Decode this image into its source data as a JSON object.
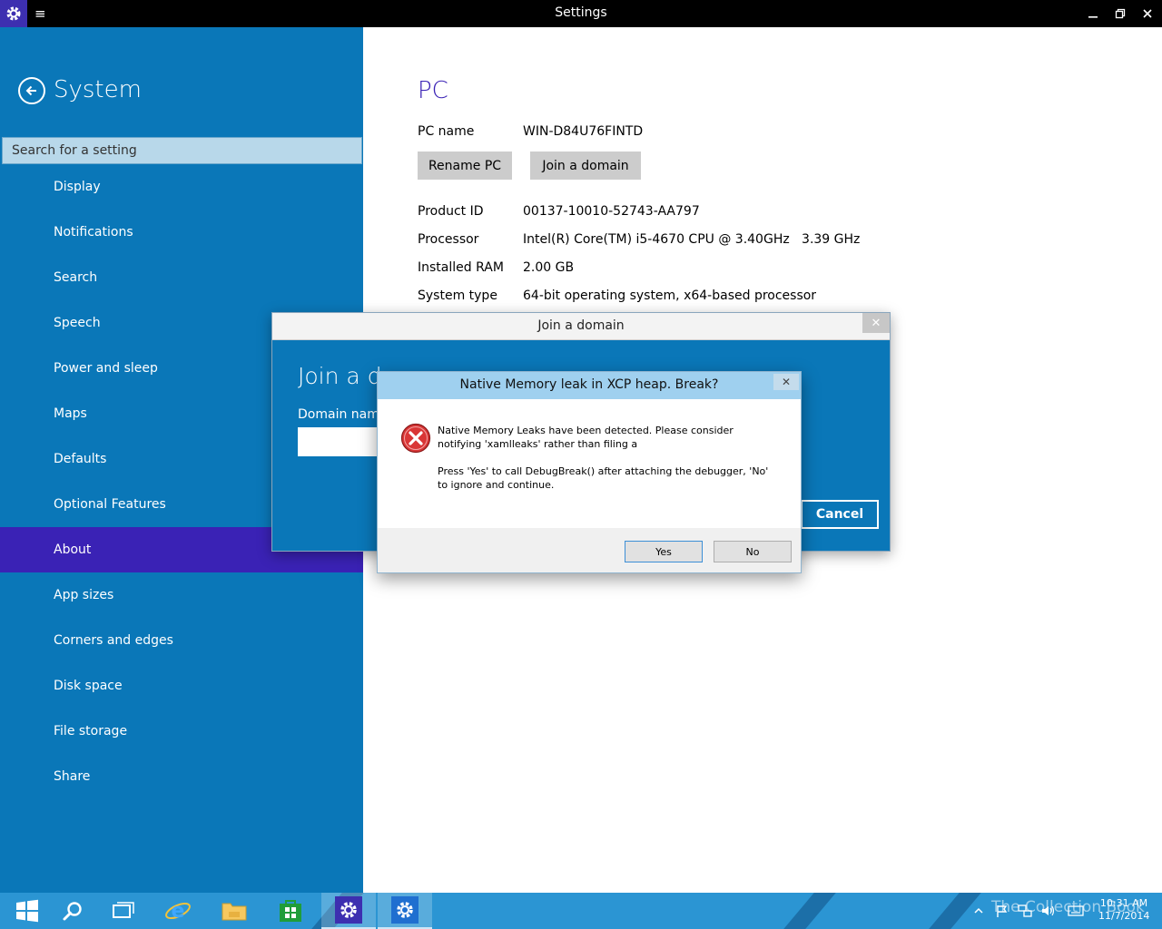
{
  "window": {
    "title": "Settings"
  },
  "sidebar": {
    "title": "System",
    "search_placeholder": "Search for a setting",
    "items": [
      {
        "label": "Display"
      },
      {
        "label": "Notifications"
      },
      {
        "label": "Search"
      },
      {
        "label": "Speech"
      },
      {
        "label": "Power and sleep"
      },
      {
        "label": "Maps"
      },
      {
        "label": "Defaults"
      },
      {
        "label": "Optional Features"
      },
      {
        "label": "About",
        "active": true
      },
      {
        "label": "App sizes"
      },
      {
        "label": "Corners and edges"
      },
      {
        "label": "Disk space"
      },
      {
        "label": "File storage"
      },
      {
        "label": "Share"
      }
    ]
  },
  "main": {
    "heading": "PC",
    "pc_name_label": "PC name",
    "pc_name_value": "WIN-D84U76FINTD",
    "rename_button": "Rename PC",
    "join_button": "Join a domain",
    "details": [
      {
        "label": "Product ID",
        "value": "00137-10010-52743-AA797"
      },
      {
        "label": "Processor",
        "value": "Intel(R) Core(TM) i5-4670 CPU @ 3.40GHz   3.39 GHz"
      },
      {
        "label": "Installed RAM",
        "value": "2.00 GB"
      },
      {
        "label": "System type",
        "value": "64-bit operating system, x64-based processor"
      }
    ]
  },
  "join_dialog": {
    "title": "Join a domain",
    "heading_visible": "Join a d",
    "domain_label_visible": "Domain name",
    "cancel_button": "Cancel"
  },
  "message_box": {
    "title": "Native Memory leak in XCP heap. Break?",
    "line1": "Native Memory Leaks have been detected. Please consider notifying 'xamlleaks' rather than filing a",
    "line2": "Press 'Yes' to call DebugBreak() after attaching the debugger, 'No' to ignore and continue.",
    "yes_button": "Yes",
    "no_button": "No",
    "icon": "error-icon"
  },
  "taskbar": {
    "watermark": "The Collection Book",
    "time": "10:31 AM",
    "date": "11/7/2014",
    "colors": {
      "background": "#2b95d3",
      "accent": "#3a22b5"
    }
  }
}
